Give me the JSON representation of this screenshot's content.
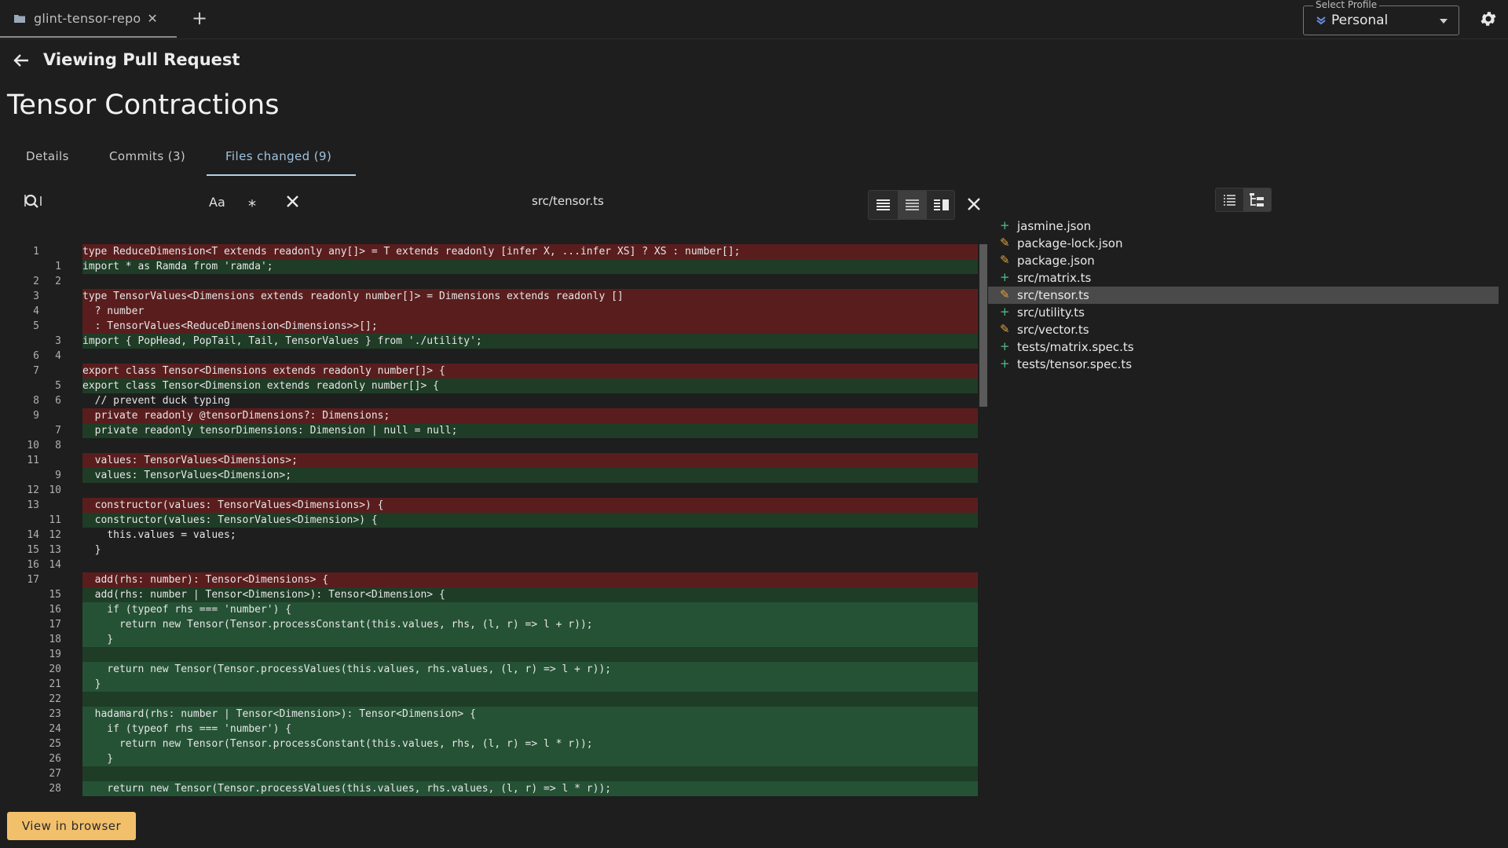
{
  "window": {
    "tab_label": "glint-tensor-repo",
    "profile_label": "Select Profile",
    "profile_value": "Personal"
  },
  "header": {
    "subtitle": "Viewing Pull Request",
    "title": "Tensor Contractions"
  },
  "tabs": [
    {
      "label": "Details"
    },
    {
      "label": "Commits (3)"
    },
    {
      "label": "Files changed (9)"
    }
  ],
  "toolbar": {
    "case_label": "Aa",
    "current_file": "src/tensor.ts"
  },
  "files": [
    {
      "name": "jasmine.json",
      "status": "added"
    },
    {
      "name": "package-lock.json",
      "status": "modified"
    },
    {
      "name": "package.json",
      "status": "modified"
    },
    {
      "name": "src/matrix.ts",
      "status": "added"
    },
    {
      "name": "src/tensor.ts",
      "status": "modified"
    },
    {
      "name": "src/utility.ts",
      "status": "added"
    },
    {
      "name": "src/vector.ts",
      "status": "modified"
    },
    {
      "name": "tests/matrix.spec.ts",
      "status": "added"
    },
    {
      "name": "tests/tensor.spec.ts",
      "status": "added"
    }
  ],
  "diff": [
    {
      "o": "1",
      "n": "",
      "t": "del",
      "c": "type ReduceDimension<T extends readonly any[]> = T extends readonly [infer X, ...infer XS] ? XS : number[];"
    },
    {
      "o": "",
      "n": "1",
      "t": "add",
      "c": "import * as Ramda from 'ramda';"
    },
    {
      "o": "2",
      "n": "2",
      "t": "ctx",
      "c": ""
    },
    {
      "o": "3",
      "n": "",
      "t": "del",
      "c": "type TensorValues<Dimensions extends readonly number[]> = Dimensions extends readonly []"
    },
    {
      "o": "4",
      "n": "",
      "t": "del",
      "c": "  ? number"
    },
    {
      "o": "5",
      "n": "",
      "t": "del",
      "c": "  : TensorValues<ReduceDimension<Dimensions>>[];"
    },
    {
      "o": "",
      "n": "3",
      "t": "add",
      "c": "import { PopHead, PopTail, Tail, TensorValues } from './utility';"
    },
    {
      "o": "6",
      "n": "4",
      "t": "ctx",
      "c": ""
    },
    {
      "o": "7",
      "n": "",
      "t": "del",
      "c": "export class Tensor<Dimensions extends readonly number[]> {"
    },
    {
      "o": "",
      "n": "5",
      "t": "add",
      "c": "export class Tensor<Dimension extends readonly number[]> {"
    },
    {
      "o": "8",
      "n": "6",
      "t": "ctx",
      "c": "  // prevent duck typing"
    },
    {
      "o": "9",
      "n": "",
      "t": "del",
      "c": "  private readonly @tensorDimensions?: Dimensions;"
    },
    {
      "o": "",
      "n": "7",
      "t": "add",
      "c": "  private readonly tensorDimensions: Dimension | null = null;"
    },
    {
      "o": "10",
      "n": "8",
      "t": "ctx",
      "c": ""
    },
    {
      "o": "11",
      "n": "",
      "t": "del",
      "c": "  values: TensorValues<Dimensions>;"
    },
    {
      "o": "",
      "n": "9",
      "t": "add",
      "c": "  values: TensorValues<Dimension>;"
    },
    {
      "o": "12",
      "n": "10",
      "t": "ctx",
      "c": ""
    },
    {
      "o": "13",
      "n": "",
      "t": "del",
      "c": "  constructor(values: TensorValues<Dimensions>) {"
    },
    {
      "o": "",
      "n": "11",
      "t": "add",
      "c": "  constructor(values: TensorValues<Dimension>) {"
    },
    {
      "o": "14",
      "n": "12",
      "t": "ctx",
      "c": "    this.values = values;"
    },
    {
      "o": "15",
      "n": "13",
      "t": "ctx",
      "c": "  }"
    },
    {
      "o": "16",
      "n": "14",
      "t": "ctx",
      "c": ""
    },
    {
      "o": "17",
      "n": "",
      "t": "del",
      "c": "  add(rhs: number): Tensor<Dimensions> {"
    },
    {
      "o": "",
      "n": "15",
      "t": "add",
      "c": "  add(rhs: number | Tensor<Dimension>): Tensor<Dimension> {"
    },
    {
      "o": "",
      "n": "16",
      "t": "addh",
      "c": "    if (typeof rhs === 'number') {"
    },
    {
      "o": "",
      "n": "17",
      "t": "addh",
      "c": "      return new Tensor(Tensor.processConstant(this.values, rhs, (l, r) => l + r));"
    },
    {
      "o": "",
      "n": "18",
      "t": "addh",
      "c": "    }"
    },
    {
      "o": "",
      "n": "19",
      "t": "add",
      "c": ""
    },
    {
      "o": "",
      "n": "20",
      "t": "addh",
      "c": "    return new Tensor(Tensor.processValues(this.values, rhs.values, (l, r) => l + r));"
    },
    {
      "o": "",
      "n": "21",
      "t": "addh",
      "c": "  }"
    },
    {
      "o": "",
      "n": "22",
      "t": "add",
      "c": ""
    },
    {
      "o": "",
      "n": "23",
      "t": "addh",
      "c": "  hadamard(rhs: number | Tensor<Dimension>): Tensor<Dimension> {"
    },
    {
      "o": "",
      "n": "24",
      "t": "addh",
      "c": "    if (typeof rhs === 'number') {"
    },
    {
      "o": "",
      "n": "25",
      "t": "addh",
      "c": "      return new Tensor(Tensor.processConstant(this.values, rhs, (l, r) => l * r));"
    },
    {
      "o": "",
      "n": "26",
      "t": "addh",
      "c": "    }"
    },
    {
      "o": "",
      "n": "27",
      "t": "add",
      "c": ""
    },
    {
      "o": "",
      "n": "28",
      "t": "addh",
      "c": "    return new Tensor(Tensor.processValues(this.values, rhs.values, (l, r) => l * r));"
    }
  ],
  "footer": {
    "view_button": "View in browser"
  },
  "colors": {
    "deleted_bg": "#5a1d1d",
    "added_bg": "#1e3c26",
    "added_file": "#4fc08d",
    "modified_file": "#e0a13d",
    "primary_button": "#f2c06b"
  }
}
